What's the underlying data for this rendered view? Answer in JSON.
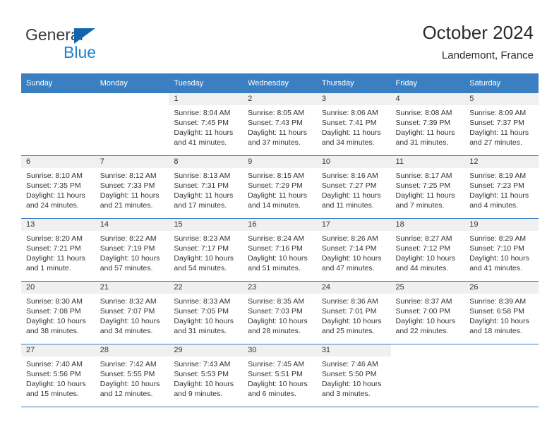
{
  "brand": {
    "name_top": "General",
    "name_bottom": "Blue",
    "accent_color": "#1b83d4",
    "triangle_color": "#1266b0"
  },
  "header": {
    "title": "October 2024",
    "subtitle": "Landemont, France"
  },
  "calendar": {
    "header_bg": "#3a7fc1",
    "daynum_bg": "#f0f0f0",
    "weekdays": [
      "Sunday",
      "Monday",
      "Tuesday",
      "Wednesday",
      "Thursday",
      "Friday",
      "Saturday"
    ],
    "weeks": [
      [
        {
          "day": "",
          "blank": true,
          "lines": []
        },
        {
          "day": "",
          "blank": true,
          "lines": []
        },
        {
          "day": "1",
          "lines": [
            "Sunrise: 8:04 AM",
            "Sunset: 7:45 PM",
            "Daylight: 11 hours",
            "and 41 minutes."
          ]
        },
        {
          "day": "2",
          "lines": [
            "Sunrise: 8:05 AM",
            "Sunset: 7:43 PM",
            "Daylight: 11 hours",
            "and 37 minutes."
          ]
        },
        {
          "day": "3",
          "lines": [
            "Sunrise: 8:06 AM",
            "Sunset: 7:41 PM",
            "Daylight: 11 hours",
            "and 34 minutes."
          ]
        },
        {
          "day": "4",
          "lines": [
            "Sunrise: 8:08 AM",
            "Sunset: 7:39 PM",
            "Daylight: 11 hours",
            "and 31 minutes."
          ]
        },
        {
          "day": "5",
          "lines": [
            "Sunrise: 8:09 AM",
            "Sunset: 7:37 PM",
            "Daylight: 11 hours",
            "and 27 minutes."
          ]
        }
      ],
      [
        {
          "day": "6",
          "lines": [
            "Sunrise: 8:10 AM",
            "Sunset: 7:35 PM",
            "Daylight: 11 hours",
            "and 24 minutes."
          ]
        },
        {
          "day": "7",
          "lines": [
            "Sunrise: 8:12 AM",
            "Sunset: 7:33 PM",
            "Daylight: 11 hours",
            "and 21 minutes."
          ]
        },
        {
          "day": "8",
          "lines": [
            "Sunrise: 8:13 AM",
            "Sunset: 7:31 PM",
            "Daylight: 11 hours",
            "and 17 minutes."
          ]
        },
        {
          "day": "9",
          "lines": [
            "Sunrise: 8:15 AM",
            "Sunset: 7:29 PM",
            "Daylight: 11 hours",
            "and 14 minutes."
          ]
        },
        {
          "day": "10",
          "lines": [
            "Sunrise: 8:16 AM",
            "Sunset: 7:27 PM",
            "Daylight: 11 hours",
            "and 11 minutes."
          ]
        },
        {
          "day": "11",
          "lines": [
            "Sunrise: 8:17 AM",
            "Sunset: 7:25 PM",
            "Daylight: 11 hours",
            "and 7 minutes."
          ]
        },
        {
          "day": "12",
          "lines": [
            "Sunrise: 8:19 AM",
            "Sunset: 7:23 PM",
            "Daylight: 11 hours",
            "and 4 minutes."
          ]
        }
      ],
      [
        {
          "day": "13",
          "lines": [
            "Sunrise: 8:20 AM",
            "Sunset: 7:21 PM",
            "Daylight: 11 hours",
            "and 1 minute."
          ]
        },
        {
          "day": "14",
          "lines": [
            "Sunrise: 8:22 AM",
            "Sunset: 7:19 PM",
            "Daylight: 10 hours",
            "and 57 minutes."
          ]
        },
        {
          "day": "15",
          "lines": [
            "Sunrise: 8:23 AM",
            "Sunset: 7:17 PM",
            "Daylight: 10 hours",
            "and 54 minutes."
          ]
        },
        {
          "day": "16",
          "lines": [
            "Sunrise: 8:24 AM",
            "Sunset: 7:16 PM",
            "Daylight: 10 hours",
            "and 51 minutes."
          ]
        },
        {
          "day": "17",
          "lines": [
            "Sunrise: 8:26 AM",
            "Sunset: 7:14 PM",
            "Daylight: 10 hours",
            "and 47 minutes."
          ]
        },
        {
          "day": "18",
          "lines": [
            "Sunrise: 8:27 AM",
            "Sunset: 7:12 PM",
            "Daylight: 10 hours",
            "and 44 minutes."
          ]
        },
        {
          "day": "19",
          "lines": [
            "Sunrise: 8:29 AM",
            "Sunset: 7:10 PM",
            "Daylight: 10 hours",
            "and 41 minutes."
          ]
        }
      ],
      [
        {
          "day": "20",
          "lines": [
            "Sunrise: 8:30 AM",
            "Sunset: 7:08 PM",
            "Daylight: 10 hours",
            "and 38 minutes."
          ]
        },
        {
          "day": "21",
          "lines": [
            "Sunrise: 8:32 AM",
            "Sunset: 7:07 PM",
            "Daylight: 10 hours",
            "and 34 minutes."
          ]
        },
        {
          "day": "22",
          "lines": [
            "Sunrise: 8:33 AM",
            "Sunset: 7:05 PM",
            "Daylight: 10 hours",
            "and 31 minutes."
          ]
        },
        {
          "day": "23",
          "lines": [
            "Sunrise: 8:35 AM",
            "Sunset: 7:03 PM",
            "Daylight: 10 hours",
            "and 28 minutes."
          ]
        },
        {
          "day": "24",
          "lines": [
            "Sunrise: 8:36 AM",
            "Sunset: 7:01 PM",
            "Daylight: 10 hours",
            "and 25 minutes."
          ]
        },
        {
          "day": "25",
          "lines": [
            "Sunrise: 8:37 AM",
            "Sunset: 7:00 PM",
            "Daylight: 10 hours",
            "and 22 minutes."
          ]
        },
        {
          "day": "26",
          "lines": [
            "Sunrise: 8:39 AM",
            "Sunset: 6:58 PM",
            "Daylight: 10 hours",
            "and 18 minutes."
          ]
        }
      ],
      [
        {
          "day": "27",
          "lines": [
            "Sunrise: 7:40 AM",
            "Sunset: 5:56 PM",
            "Daylight: 10 hours",
            "and 15 minutes."
          ]
        },
        {
          "day": "28",
          "lines": [
            "Sunrise: 7:42 AM",
            "Sunset: 5:55 PM",
            "Daylight: 10 hours",
            "and 12 minutes."
          ]
        },
        {
          "day": "29",
          "lines": [
            "Sunrise: 7:43 AM",
            "Sunset: 5:53 PM",
            "Daylight: 10 hours",
            "and 9 minutes."
          ]
        },
        {
          "day": "30",
          "lines": [
            "Sunrise: 7:45 AM",
            "Sunset: 5:51 PM",
            "Daylight: 10 hours",
            "and 6 minutes."
          ]
        },
        {
          "day": "31",
          "lines": [
            "Sunrise: 7:46 AM",
            "Sunset: 5:50 PM",
            "Daylight: 10 hours",
            "and 3 minutes."
          ]
        },
        {
          "day": "",
          "blank": true,
          "lines": []
        },
        {
          "day": "",
          "blank": true,
          "lines": []
        }
      ]
    ]
  }
}
